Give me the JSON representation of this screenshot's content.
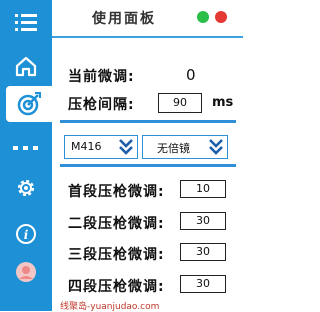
{
  "header": {
    "title": "使用面板"
  },
  "sidebar": {
    "items": [
      "menu-icon",
      "home-icon",
      "target-icon",
      "more-icon",
      "gear-icon",
      "info-icon",
      "avatar-icon"
    ]
  },
  "main": {
    "current_adjust": {
      "label": "当前微调:",
      "value": "0"
    },
    "interval": {
      "label": "压枪间隔:",
      "value": "90",
      "unit": "ms"
    },
    "weapon_select": {
      "value": "M416"
    },
    "scope_select": {
      "value": "无倍镜"
    },
    "stages": [
      {
        "label": "首段压枪微调:",
        "value": "10"
      },
      {
        "label": "二段压枪微调:",
        "value": "30"
      },
      {
        "label": "三段压枪微调:",
        "value": "30"
      },
      {
        "label": "四段压枪微调:",
        "value": "30"
      }
    ]
  },
  "watermark": "线聚岛-yuanjudao.com",
  "colors": {
    "sidebar": "#1e90d6",
    "accent": "#2f8fd8",
    "green": "#2bbf4a",
    "red": "#e53935"
  }
}
